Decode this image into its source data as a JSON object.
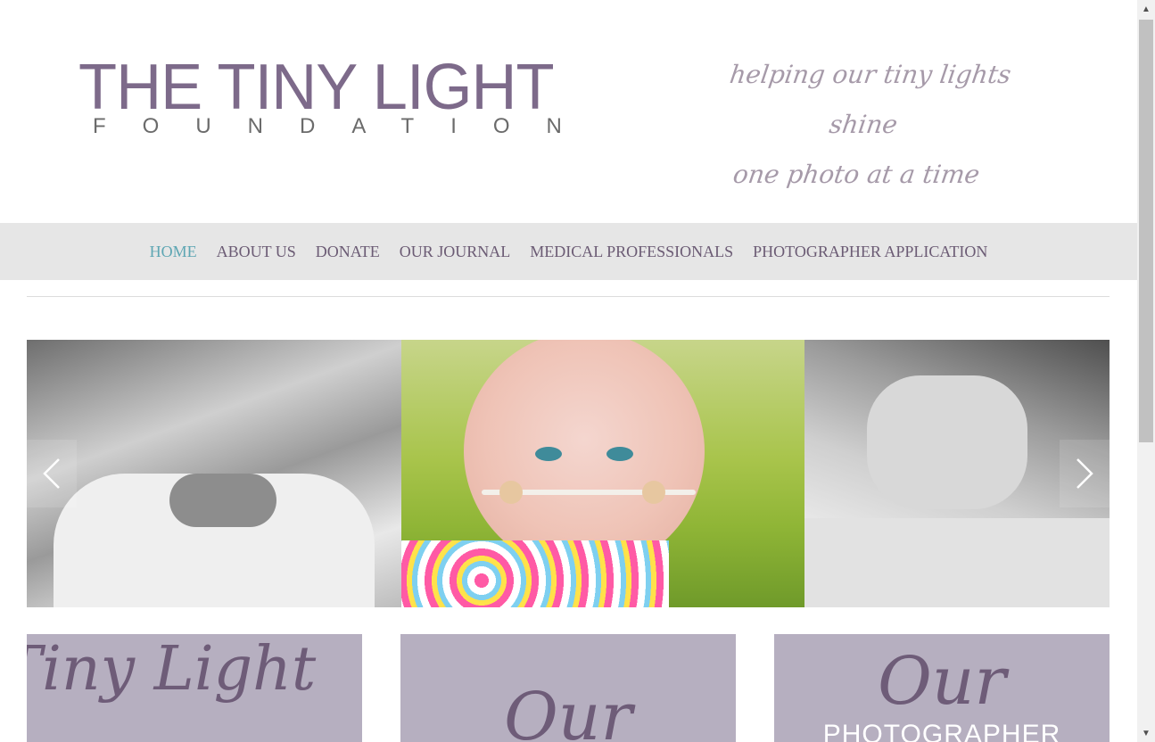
{
  "header": {
    "logo_title": "THE TINY LIGHT",
    "logo_subtitle": "FOUNDATION",
    "tagline_line1": "helping our tiny lights shine",
    "tagline_line2": "one photo at a time"
  },
  "nav": {
    "items": [
      {
        "label": "HOME",
        "active": true
      },
      {
        "label": "ABOUT US",
        "active": false
      },
      {
        "label": "DONATE",
        "active": false
      },
      {
        "label": "OUR JOURNAL",
        "active": false
      },
      {
        "label": "MEDICAL PROFESSIONALS",
        "active": false
      },
      {
        "label": "PHOTOGRAPHER APPLICATION",
        "active": false
      }
    ]
  },
  "slider": {
    "prev_icon": "chevron-left-icon",
    "next_icon": "chevron-right-icon"
  },
  "tiles": [
    {
      "script": "Tiny Light",
      "caps": ""
    },
    {
      "script": "Our",
      "caps": ""
    },
    {
      "script": "Our",
      "caps": "PHOTOGRAPHER"
    }
  ],
  "colors": {
    "accent_active": "#5ea6b3",
    "nav_text": "#6b5b74",
    "nav_bg": "#e6e6e6",
    "tile_bg": "#b6afc0",
    "logo": "#7d6a8a"
  }
}
